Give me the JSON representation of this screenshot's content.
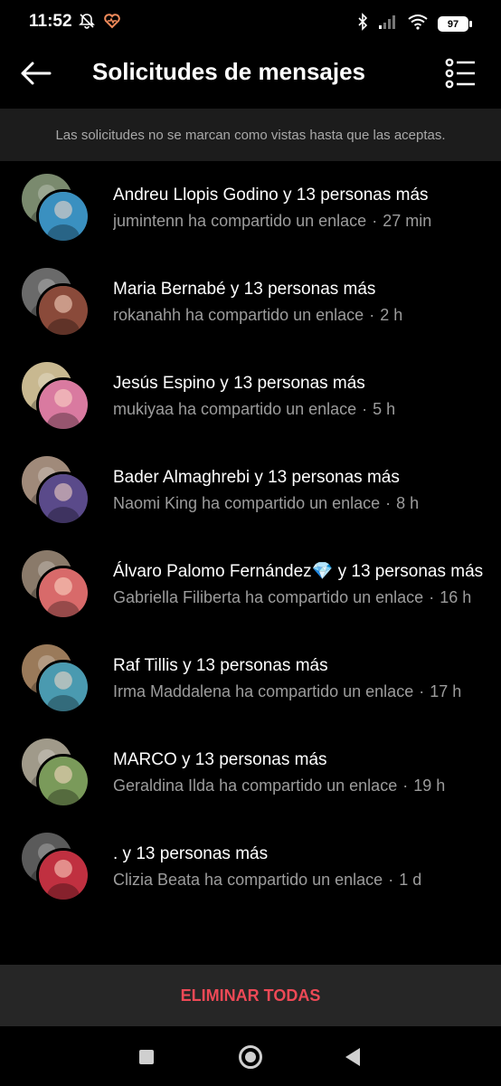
{
  "status_bar": {
    "time": "11:52",
    "battery": "97",
    "icons": [
      "bell-muted-icon",
      "heart-app-icon",
      "bluetooth-icon",
      "signal-icon",
      "wifi-icon",
      "battery-icon"
    ]
  },
  "header": {
    "title": "Solicitudes de mensajes",
    "back_icon": "back-arrow-icon",
    "options_icon": "list-options-icon"
  },
  "notice": "Las solicitudes no se marcan como vistas hasta que las aceptas.",
  "requests": [
    {
      "title": "Andreu Llopis Godino y 13 personas más",
      "message": "jumintenn ha compartido un enlace",
      "time": "27 min",
      "colors": [
        "#7a8a6e",
        "#3a90c0"
      ]
    },
    {
      "title": "Maria Bernabé y 13 personas más",
      "message": "rokanahh ha compartido un enlace",
      "time": "2 h",
      "colors": [
        "#6a6a6a",
        "#8a4a3a"
      ]
    },
    {
      "title": "Jesús Espino y 13 personas más",
      "message": "mukiyaa ha compartido un enlace",
      "time": "5 h",
      "colors": [
        "#c8b890",
        "#d97aa0"
      ]
    },
    {
      "title": "Bader Almaghrebi y 13 personas más",
      "message": "Naomi King ha compartido un enlace",
      "time": "8 h",
      "colors": [
        "#a08a7a",
        "#5a4a8a"
      ]
    },
    {
      "title": "Álvaro Palomo Fernández💎 y 13 personas más",
      "message": "Gabriella Filiberta ha compartido un enlace",
      "time": "16 h",
      "colors": [
        "#8a7a6a",
        "#d86a6a"
      ]
    },
    {
      "title": "Raf Tillis y 13 personas más",
      "message": "Irma Maddalena ha compartido un enlace",
      "time": "17 h",
      "colors": [
        "#9a7a5a",
        "#4a9ab0"
      ]
    },
    {
      "title": "MARCO y 13 personas más",
      "message": "Geraldina Ilda ha compartido un enlace",
      "time": "19 h",
      "colors": [
        "#a09a8a",
        "#7a9a5a"
      ]
    },
    {
      "title": ". y 13 personas más",
      "message": "Clizia Beata ha compartido un enlace",
      "time": "1 d",
      "colors": [
        "#5a5a5a",
        "#c03040"
      ]
    }
  ],
  "delete_all_label": "ELIMINAR TODAS",
  "accent_color": "#ed4956"
}
